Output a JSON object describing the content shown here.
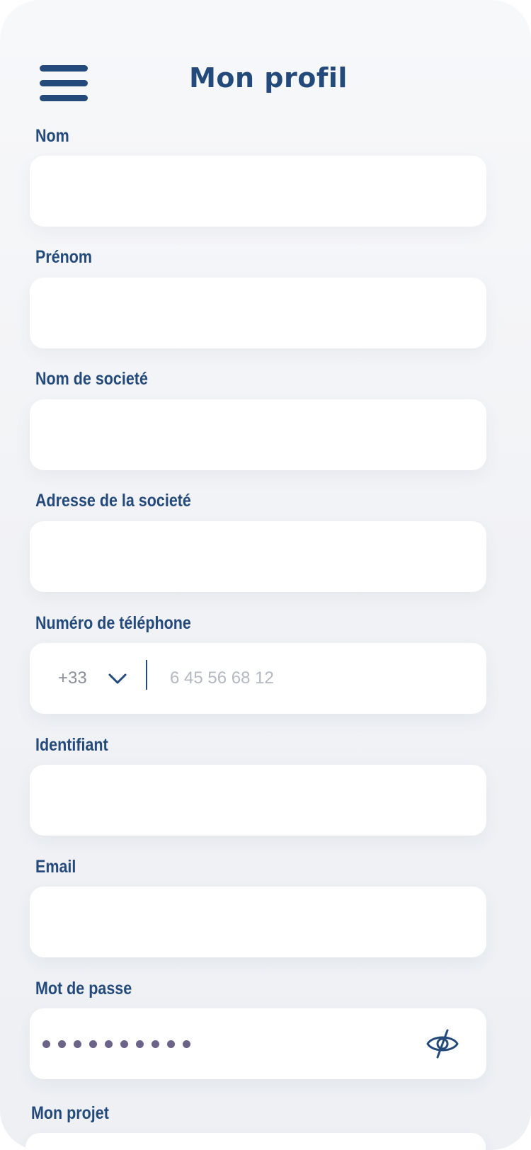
{
  "header": {
    "title": "Mon profil"
  },
  "form": {
    "nom": {
      "label": "Nom",
      "value": ""
    },
    "prenom": {
      "label": "Prénom",
      "value": ""
    },
    "societe": {
      "label": "Nom de societé",
      "value": ""
    },
    "adresse": {
      "label": "Adresse de la societé",
      "value": ""
    },
    "telephone": {
      "label": "Numéro de téléphone",
      "country_code": "+33",
      "placeholder": "6 45 56 68 12",
      "value": ""
    },
    "identifiant": {
      "label": "Identifiant",
      "value": ""
    },
    "email": {
      "label": "Email",
      "value": ""
    },
    "password": {
      "label": "Mot de passe",
      "masked_length": 10
    },
    "projet": {
      "label": "Mon projet"
    }
  },
  "colors": {
    "primary": "#234a7a",
    "background": "#f1f2f5",
    "field": "#ffffff",
    "password_dot": "#6b6388",
    "placeholder": "#b4b8c0"
  },
  "icons": {
    "menu": "hamburger-icon",
    "dropdown": "chevron-down-icon",
    "visibility": "eye-off-icon"
  }
}
